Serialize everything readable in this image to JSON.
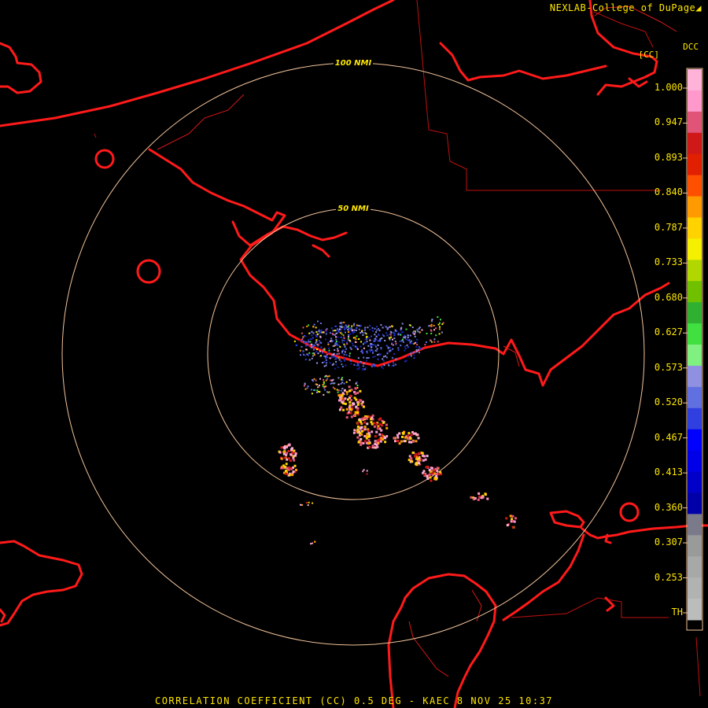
{
  "header": {
    "credit": "NEXLAB-College of DuPage",
    "credit_icon": "logo-mark-icon",
    "product_code": "DCC",
    "unit": "[CC]"
  },
  "map": {
    "range_rings": [
      {
        "label": "100 NMI"
      },
      {
        "label": "50 NMI"
      }
    ],
    "colors": {
      "background": "#000000",
      "coastline": "#ff1a1a",
      "county_lines": "#c01010",
      "range_rings": "#f2c39a",
      "text": "#ffe600"
    }
  },
  "legend": {
    "labels": [
      "1.000",
      "0.947",
      "0.893",
      "0.840",
      "0.787",
      "0.733",
      "0.680",
      "0.627",
      "0.573",
      "0.520",
      "0.467",
      "0.413",
      "0.360",
      "0.307",
      "0.253",
      "TH"
    ],
    "color_stops": [
      "#ffb3d9",
      "#ff99cc",
      "#e05577",
      "#d01818",
      "#e02000",
      "#ff5000",
      "#ff9a00",
      "#ffd200",
      "#f5f000",
      "#b0d800",
      "#70c000",
      "#30b030",
      "#40e040",
      "#80f080",
      "#9090e0",
      "#6070e0",
      "#3040e0",
      "#0000ff",
      "#0000e8",
      "#0000c8",
      "#0000a8",
      "#7a7a8a",
      "#9a9a9a",
      "#a8a8a8",
      "#b2b2b2",
      "#bcbcbc"
    ]
  },
  "footer": {
    "caption": "CORRELATION COEFFICIENT (CC) 0.5 DEG - KAEC 8 NOV 25 10:37"
  }
}
